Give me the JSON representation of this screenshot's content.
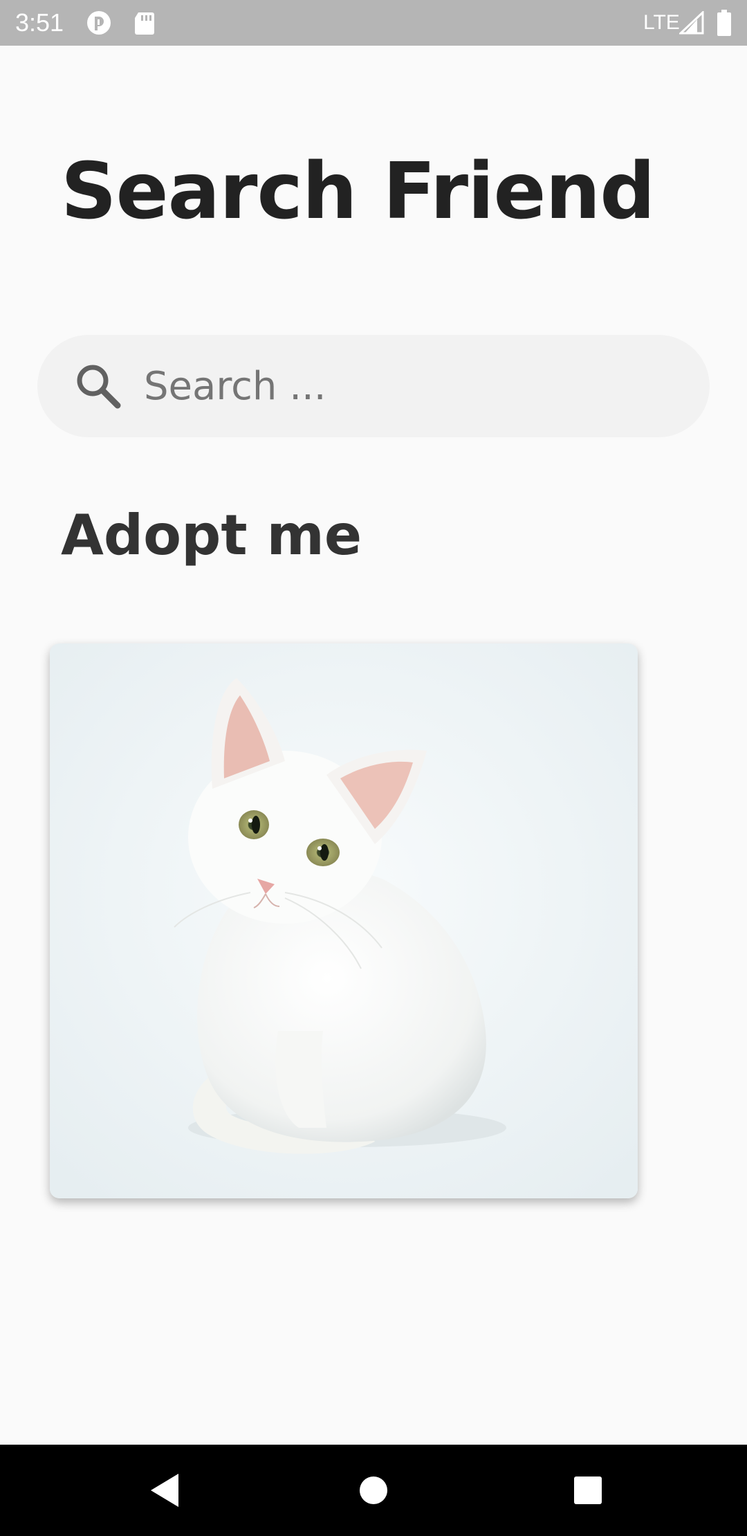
{
  "status_bar": {
    "time": "3:51",
    "network": "LTE",
    "icons": [
      "notification-icon",
      "sd-card-icon",
      "signal-icon",
      "battery-icon"
    ]
  },
  "header": {
    "title": "Search Friend"
  },
  "search": {
    "placeholder": "Search ...",
    "value": "",
    "icon": "search-icon"
  },
  "section": {
    "title": "Adopt me"
  },
  "pets": [
    {
      "image": "white-kitten-photo"
    }
  ],
  "nav": {
    "buttons": [
      "back-icon",
      "home-icon",
      "recents-icon"
    ]
  },
  "colors": {
    "background": "#fafafa",
    "status_bar": "#b5b5b5",
    "title_text": "#222222",
    "search_bg": "#f2f2f2",
    "nav_bar": "#000000"
  }
}
